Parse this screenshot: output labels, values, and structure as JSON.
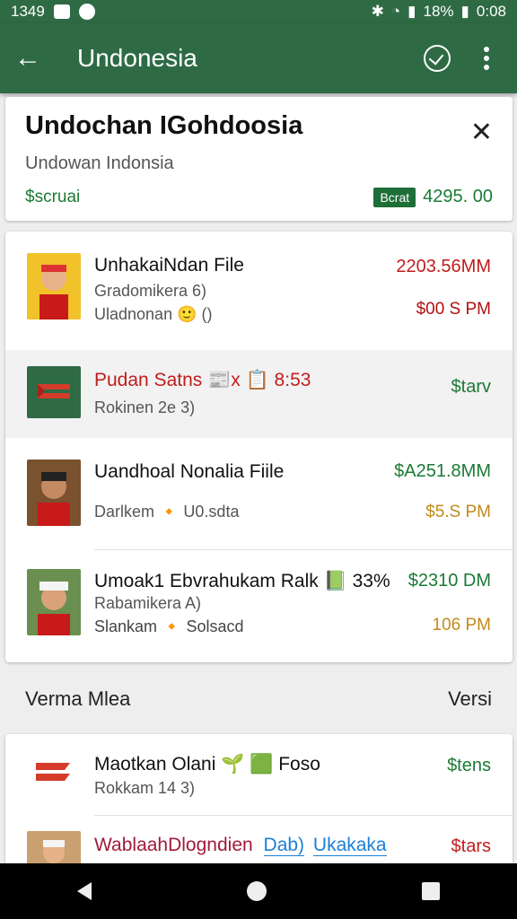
{
  "status": {
    "time": "1349",
    "battery": "18%",
    "clock": "0:08"
  },
  "appbar": {
    "title": "Undonesia"
  },
  "header": {
    "title": "Undochan IGohdoosia",
    "subtitle": "Undowan Indonsia",
    "status": "$scruai",
    "badge": "Bcrat",
    "total": "4295. 00"
  },
  "transactions": [
    {
      "title": "UnhakaiNdan File",
      "line2": "Gradomikera 6)",
      "line3": "Uladnonan 🙂 ()",
      "amount": "2203.56MM",
      "time": "$00 S PM",
      "amount_color": "#c01c1c",
      "time_color": "#b21010"
    },
    {
      "title": "Pudan Satns 📰x 📋 8:53",
      "line2": "Rokinen 2e 3)",
      "line3": "",
      "amount": "$tarv",
      "time": "",
      "amount_color": "#1b7a34",
      "time_color": "#444444"
    },
    {
      "title": "Uandhoal Nonalia Fiile",
      "line2": "Darlkem 🔸 U0.sdta",
      "line3": "",
      "amount": "$A251.8MM",
      "time": "$5.S PM",
      "amount_color": "#1b7a34",
      "time_color": "#c28a19"
    },
    {
      "title": "Umoak1 Ebvrahukam Ralk 📗 33%",
      "line2": "Rabamikera A)",
      "line3": "Slankam 🔸 Solsacd",
      "amount": "$2310 DM",
      "time": "106 PM",
      "amount_color": "#1b7a34",
      "time_color": "#c28a19"
    }
  ],
  "section": {
    "left": "Verma Mlea",
    "right": "Versi"
  },
  "bottom_items": [
    {
      "title": "Maotkan Olani 🌱 🟩 Foso",
      "line2": "Rokkam 14 3)",
      "amount": "$tens",
      "amount_color": "#1b7a34"
    },
    {
      "title": "WablaahDlogndien",
      "chip1": "Dab)",
      "chip2": "Ukakaka",
      "amount": "$tars",
      "amount_color": "#c01c1c"
    }
  ]
}
